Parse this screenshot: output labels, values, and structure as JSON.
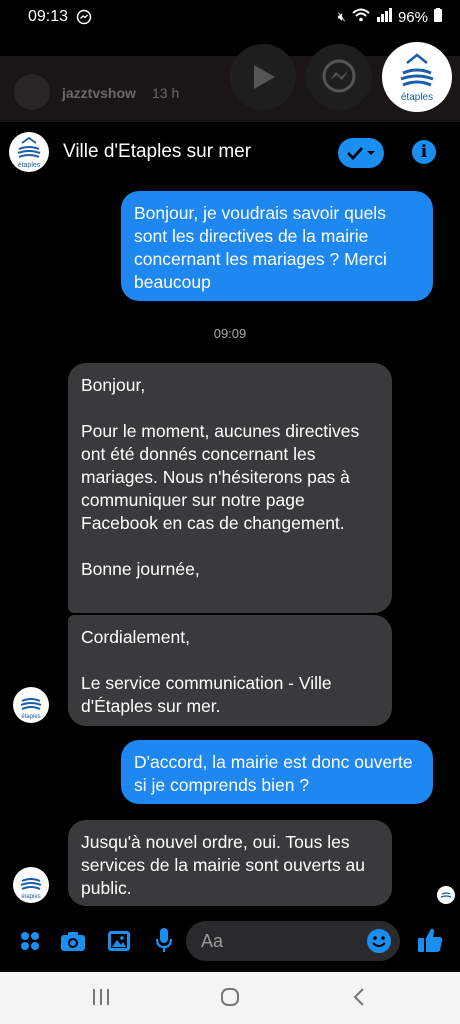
{
  "status": {
    "time": "09:13",
    "battery": "96%"
  },
  "strip": {
    "name": "jazztvshow",
    "time": "13 h"
  },
  "header": {
    "title": "Ville d'Etaples sur mer",
    "brand": "étaples"
  },
  "messages": {
    "m1": "Bonjour, je voudrais savoir quels sont les directives de la mairie concernant les mariages ? Merci beaucoup",
    "timestamp": "09:09",
    "m2": "Bonjour,\n\nPour le moment, aucunes directives ont été donnés concernant les mariages. Nous n'hésiterons pas à communiquer sur notre page Facebook en cas de changement.\n\nBonne journée,",
    "m3": "Cordialement,\n\nLe service communication - Ville d'Étaples sur mer.",
    "m4": "D'accord, la mairie est donc ouverte si je comprends bien ?",
    "m5": "Jusqu'à nouvel ordre, oui. Tous les services de la mairie sont ouverts au public."
  },
  "composer": {
    "placeholder": "Aa"
  },
  "colors": {
    "accent": "#1e88f0",
    "incoming": "#3a3a3c"
  }
}
